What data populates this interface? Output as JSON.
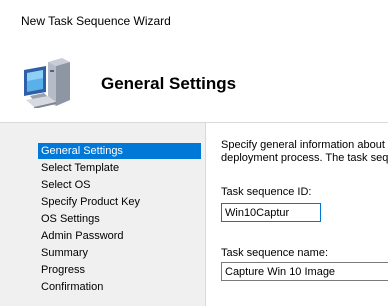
{
  "window": {
    "title": "New Task Sequence Wizard"
  },
  "header": {
    "icon": "computer-icon",
    "heading": "General Settings"
  },
  "nav": {
    "items": [
      {
        "label": "General Settings",
        "active": true
      },
      {
        "label": "Select Template"
      },
      {
        "label": "Select OS"
      },
      {
        "label": "Specify Product Key"
      },
      {
        "label": "OS Settings"
      },
      {
        "label": "Admin Password"
      },
      {
        "label": "Summary"
      },
      {
        "label": "Progress"
      },
      {
        "label": "Confirmation"
      }
    ]
  },
  "content": {
    "description_line1": "Specify general information about th",
    "description_line2": "deployment process.  The task sequ",
    "id_label": "Task sequence ID:",
    "id_value": "Win10Captur",
    "name_label": "Task sequence name:",
    "name_value": "Capture Win 10 Image"
  },
  "colors": {
    "accent": "#0078d7",
    "pane_bg": "#f0f0f0"
  }
}
